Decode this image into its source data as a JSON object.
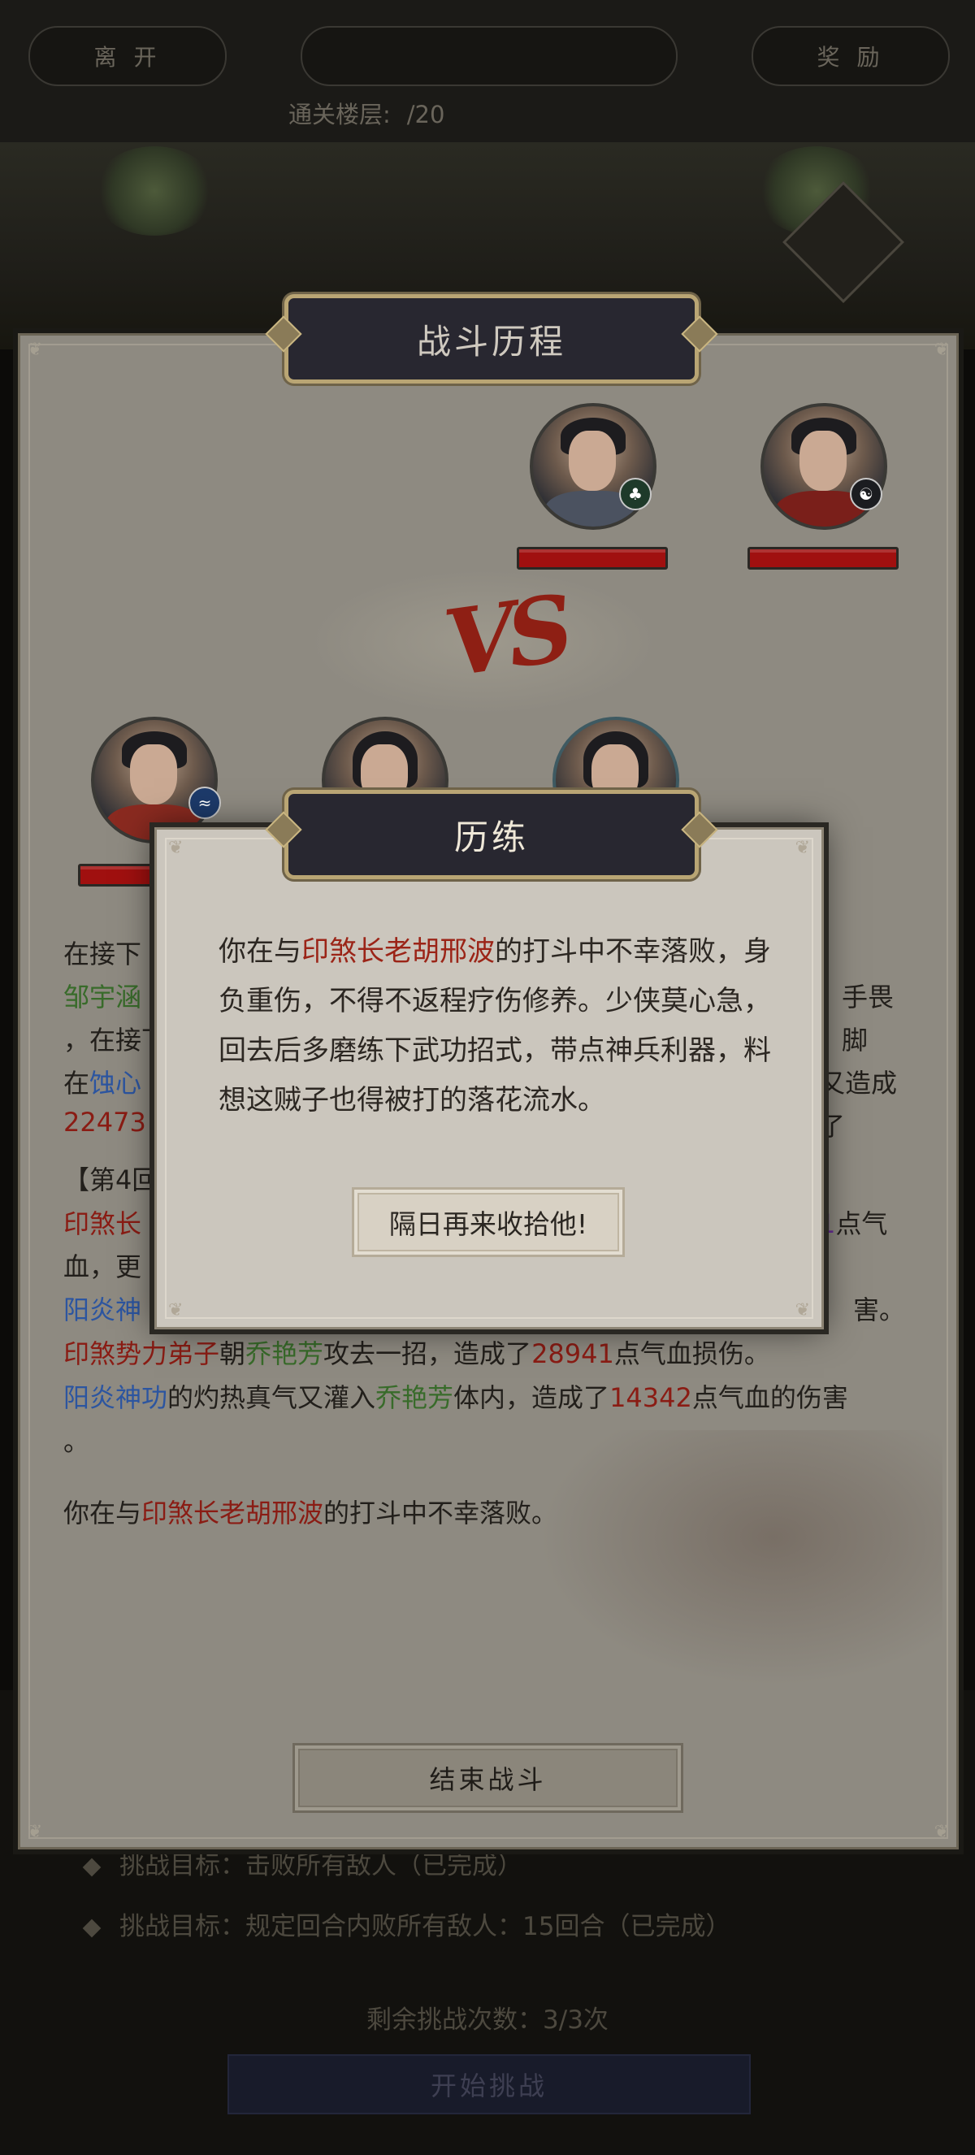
{
  "topbar": {
    "leave_label": "离 开",
    "tower_title": "",
    "reward_label": "奖 励",
    "floor_label": "通关楼层:",
    "floor_value": "/20"
  },
  "battle_panel": {
    "title": "战斗历程",
    "vs_text": "VS",
    "log": {
      "line1_frag": "在接下",
      "line2_name": "邹宇涵",
      "line2_tail": "手畏脚",
      "line3_frag": "，在接下",
      "line4_pre": "在",
      "line4_skill": "蚀心",
      "line4_tail": "又造成了",
      "line5_num": "22473",
      "round_header": "【第4回",
      "line7_name": "印煞长",
      "line7_num": "1",
      "line7_tail": "点气",
      "line8": "血，更",
      "line9_skill": "阳炎神",
      "line9_tail": "害。",
      "line10_attacker": "印煞势力弟子",
      "line10_mid": "朝",
      "line10_target": "乔艳芳",
      "line10_mid2": "攻去一招，造成了",
      "line10_dmg": "28941",
      "line10_end": "点气血损伤。",
      "line11_skill": "阳炎神功",
      "line11_mid": "的灼热真气又灌入",
      "line11_target": "乔艳芳",
      "line11_mid2": "体内，造成了",
      "line11_dmg": "14342",
      "line11_end": "点气血的伤害",
      "line12": "。",
      "result_pre": "你在与",
      "result_enemy": "印煞长老胡邢波",
      "result_post": "的打斗中不幸落败。"
    },
    "end_button": "结束战斗"
  },
  "base_screen": {
    "goal1": "挑战目标：击败所有敌人（已完成）",
    "goal2": "挑战目标：规定回合内败所有敌人：15回合（已完成）",
    "remaining": "剩余挑战次数：3/3次",
    "start_button": "开始挑战"
  },
  "modal": {
    "title": "历练",
    "text_pre": "你在与",
    "text_enemy": "印煞长老胡邢波",
    "text_post": "的打斗中不幸落败，身负重伤，不得不返程疗伤修养。少侠莫心急，回去后多磨练下武功招式，带点神兵利器，料想这贼子也得被打的落花流水。",
    "button": "隔日再来收拾他!"
  },
  "icons": {
    "enemy1_badge": "tree-icon",
    "enemy2_badge": "yin-yang-icon",
    "ally1_badge": "water-icon"
  },
  "colors": {
    "enemy_name": "#9b2417",
    "ally_name": "#386b2a",
    "skill": "#2c55a0",
    "hp_bar": "#a0100f",
    "title_plate": "#282730",
    "title_border": "#b9a574"
  }
}
